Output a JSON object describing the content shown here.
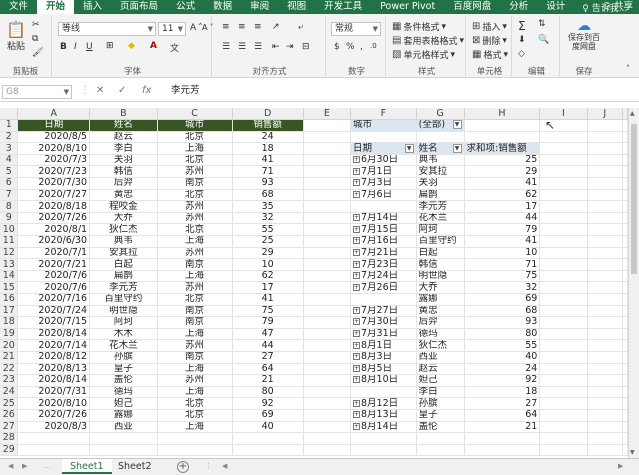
{
  "menu": {
    "tabs": [
      "文件",
      "开始",
      "插入",
      "页面布局",
      "公式",
      "数据",
      "审阅",
      "视图",
      "开发工具",
      "Power Pivot",
      "百度网盘",
      "分析",
      "设计"
    ],
    "active_index": 1,
    "tell_me": "告诉我...",
    "share": "共享"
  },
  "ribbon": {
    "clipboard": {
      "paste": "粘贴",
      "label": "剪贴板"
    },
    "font": {
      "font_name": "等线",
      "font_size": "11",
      "label": "字体",
      "bold": "B",
      "italic": "I",
      "underline": "U",
      "grow": "A",
      "shrink": "A"
    },
    "alignment": {
      "label": "对齐方式"
    },
    "number": {
      "format": "常规",
      "label": "数字"
    },
    "styles": {
      "conditional": "条件格式",
      "table": "套用表格格式",
      "cell": "单元格样式",
      "label": "样式"
    },
    "cells": {
      "insert": "插入",
      "delete": "删除",
      "format": "格式",
      "label": "单元格"
    },
    "editing": {
      "label": "编辑"
    },
    "baidu": {
      "save": "保存到百度网盘",
      "label": "保存"
    }
  },
  "formula_bar": {
    "name_box": "G8",
    "content": "李元芳",
    "cancel": "✕",
    "enter": "✓",
    "fx": "fx"
  },
  "columns": [
    "A",
    "B",
    "C",
    "D",
    "E",
    "F",
    "G",
    "H",
    "I",
    "J"
  ],
  "table": {
    "headers": [
      "日期",
      "姓名",
      "城市",
      "销售额"
    ],
    "rows": [
      [
        "2020/8/5",
        "赵云",
        "北京",
        "24"
      ],
      [
        "2020/8/10",
        "李白",
        "上海",
        "18"
      ],
      [
        "2020/7/3",
        "关羽",
        "北京",
        "41"
      ],
      [
        "2020/7/23",
        "韩信",
        "苏州",
        "71"
      ],
      [
        "2020/7/30",
        "后羿",
        "南京",
        "93"
      ],
      [
        "2020/7/27",
        "黄忠",
        "北京",
        "68"
      ],
      [
        "2020/8/18",
        "程咬金",
        "苏州",
        "35"
      ],
      [
        "2020/7/26",
        "大乔",
        "苏州",
        "32"
      ],
      [
        "2020/8/1",
        "狄仁杰",
        "北京",
        "55"
      ],
      [
        "2020/6/30",
        "典韦",
        "上海",
        "25"
      ],
      [
        "2020/7/1",
        "安其拉",
        "苏州",
        "29"
      ],
      [
        "2020/7/21",
        "白起",
        "南京",
        "10"
      ],
      [
        "2020/7/6",
        "扁鹊",
        "上海",
        "62"
      ],
      [
        "2020/7/6",
        "李元芳",
        "苏州",
        "17"
      ],
      [
        "2020/7/16",
        "百里守约",
        "北京",
        "41"
      ],
      [
        "2020/7/24",
        "明世隐",
        "南京",
        "75"
      ],
      [
        "2020/7/15",
        "阿珂",
        "南京",
        "79"
      ],
      [
        "2020/8/14",
        "木木",
        "上海",
        "47"
      ],
      [
        "2020/7/14",
        "花木兰",
        "苏州",
        "44"
      ],
      [
        "2020/8/12",
        "孙膑",
        "南京",
        "27"
      ],
      [
        "2020/8/13",
        "皇子",
        "上海",
        "64"
      ],
      [
        "2020/8/14",
        "盖伦",
        "苏州",
        "21"
      ],
      [
        "2020/7/31",
        "德玛",
        "上海",
        "80"
      ],
      [
        "2020/8/10",
        "妲己",
        "北京",
        "92"
      ],
      [
        "2020/7/26",
        "露娜",
        "北京",
        "69"
      ],
      [
        "2020/8/3",
        "西亚",
        "上海",
        "40"
      ]
    ]
  },
  "pivot": {
    "filter_field": "城市",
    "filter_value": "(全部)",
    "row_header": "日期",
    "col_header": "姓名",
    "value_header": "求和项:销售额",
    "rows": [
      [
        "6月30日",
        "典韦",
        "25"
      ],
      [
        "7月1日",
        "安其拉",
        "29"
      ],
      [
        "7月3日",
        "关羽",
        "41"
      ],
      [
        "7月6日",
        "扁鹊",
        "62"
      ],
      [
        "",
        "李元芳",
        "17"
      ],
      [
        "7月14日",
        "花木兰",
        "44"
      ],
      [
        "7月15日",
        "阿珂",
        "79"
      ],
      [
        "7月16日",
        "百里守约",
        "41"
      ],
      [
        "7月21日",
        "白起",
        "10"
      ],
      [
        "7月23日",
        "韩信",
        "71"
      ],
      [
        "7月24日",
        "明世隐",
        "75"
      ],
      [
        "7月26日",
        "大乔",
        "32"
      ],
      [
        "",
        "露娜",
        "69"
      ],
      [
        "7月27日",
        "黄忠",
        "68"
      ],
      [
        "7月30日",
        "后羿",
        "93"
      ],
      [
        "7月31日",
        "德玛",
        "80"
      ],
      [
        "8月1日",
        "狄仁杰",
        "55"
      ],
      [
        "8月3日",
        "西亚",
        "40"
      ],
      [
        "8月5日",
        "赵云",
        "24"
      ],
      [
        "8月10日",
        "妲己",
        "92"
      ],
      [
        "",
        "李白",
        "18"
      ],
      [
        "8月12日",
        "孙膑",
        "27"
      ],
      [
        "8月13日",
        "皇子",
        "64"
      ],
      [
        "8月14日",
        "盖伦",
        "21"
      ]
    ]
  },
  "sheet_tabs": [
    "Sheet1",
    "Sheet2"
  ],
  "active_sheet": "Sheet1",
  "colors": {
    "excel_green": "#217346",
    "header_fill": "#375623",
    "pivot_fill": "#dce6f1",
    "border_orange": "#f0c08a"
  }
}
